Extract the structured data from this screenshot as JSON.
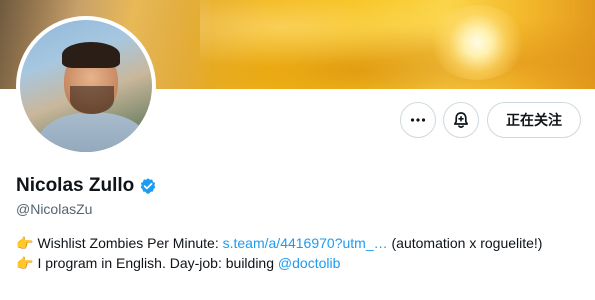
{
  "profile": {
    "name": "Nicolas Zullo",
    "handle": "@NicolasZu",
    "verified": true
  },
  "actions": {
    "more_icon": "more-icon",
    "bell_icon": "notification-bell-icon",
    "follow_label": "正在关注"
  },
  "bio": {
    "line1_emoji": "👉",
    "line1_text": "Wishlist Zombies Per Minute: ",
    "line1_link": "s.team/a/4416970?utm_…",
    "line1_suffix": " (automation x roguelite!)",
    "line2_emoji": "👉",
    "line2_text": "I program in English. Day-job: building ",
    "line2_link": "@doctolib"
  },
  "colors": {
    "link": "#1d9bf0",
    "verified": "#1d9bf0",
    "text": "#0f1419",
    "muted": "#536471"
  }
}
